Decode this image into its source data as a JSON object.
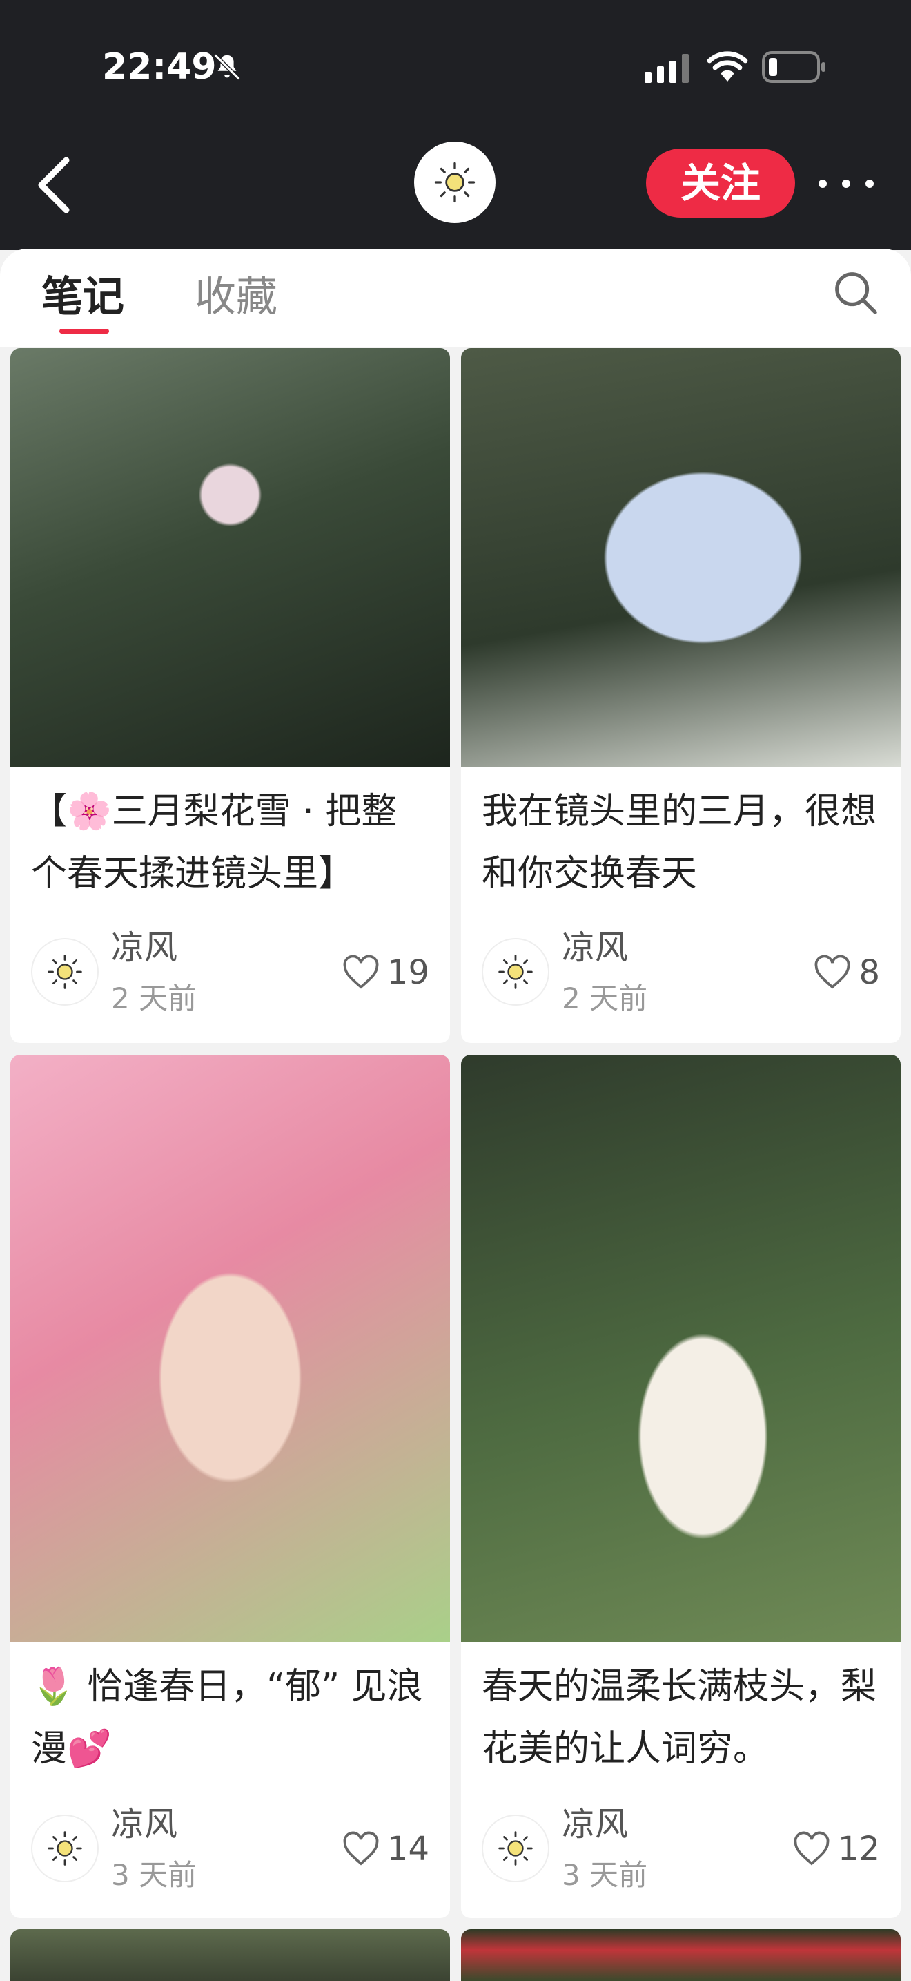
{
  "status_bar": {
    "time": "22:49"
  },
  "header": {
    "follow_label": "关注"
  },
  "tabs": [
    {
      "label": "笔记",
      "active": true
    },
    {
      "label": "收藏",
      "active": false
    }
  ],
  "posts": [
    {
      "title": "【🌸三月梨花雪 · 把整个春天揉进镜头里】",
      "author": "凉风",
      "time": "2 天前",
      "likes": "19",
      "image": "woman-black-blazer-blossoms"
    },
    {
      "title": "我在镜头里的三月，很想和你交换春天",
      "author": "凉风",
      "time": "2 天前",
      "likes": "8",
      "image": "woman-blue-shirt-glasses-water"
    },
    {
      "title": "🌷 恰逢春日，“郁” 见浪漫💕",
      "author": "凉风",
      "time": "3 天前",
      "likes": "14",
      "image": "woman-pink-tulips"
    },
    {
      "title": "春天的温柔长满枝头，梨花美的让人词穷。",
      "author": "凉风",
      "time": "3 天前",
      "likes": "12",
      "image": "woman-white-dress-tree"
    }
  ],
  "colors": {
    "accent": "#ee2b45",
    "header_bg": "#1f2024"
  }
}
